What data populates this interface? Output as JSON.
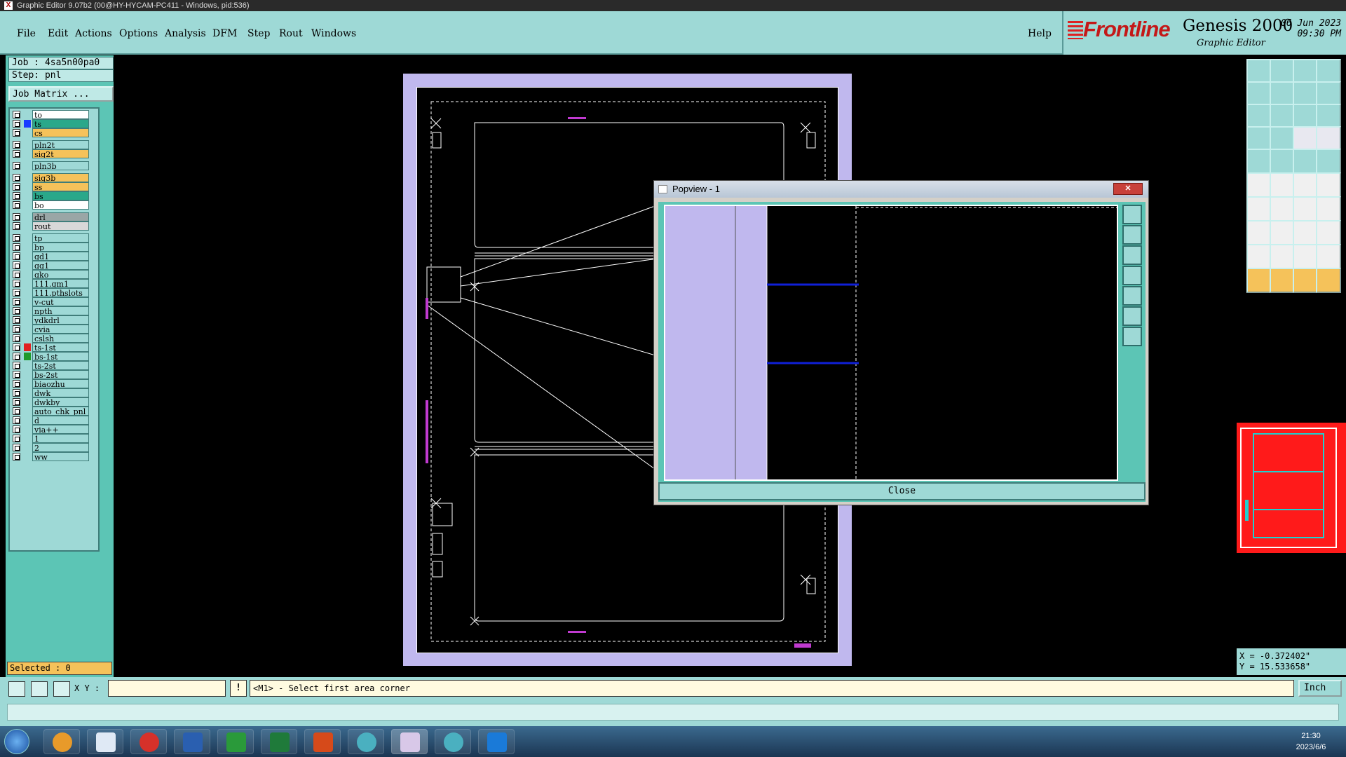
{
  "window": {
    "title": "Graphic Editor 9.07b2 (00@HY-HYCAM-PC411 - Windows, pid:536)"
  },
  "menu": {
    "items": [
      "File",
      "Edit",
      "Actions",
      "Options",
      "Analysis",
      "DFM",
      "Step",
      "Rout",
      "Windows"
    ],
    "help": "Help"
  },
  "brand": {
    "logo": "Frontline",
    "product": "Genesis 2000",
    "subtitle": "Graphic Editor",
    "date": "06 Jun 2023",
    "time": "09:30 PM"
  },
  "job": {
    "job_label": "Job : 4sa5n00pa0",
    "step_label": "Step: pnl",
    "matrix_button": "Job Matrix ..."
  },
  "layers": [
    {
      "name": "to",
      "color": "#ffffff",
      "swatch": ""
    },
    {
      "name": "ts",
      "color": "#2aa88a",
      "swatch": "#1a3cff"
    },
    {
      "name": "cs",
      "color": "#f5c25a",
      "swatch": ""
    },
    {
      "name": "pln2t",
      "color": "#9ed9d6",
      "swatch": ""
    },
    {
      "name": "sig2t",
      "color": "#f5c25a",
      "swatch": ""
    },
    {
      "name": "pln3b",
      "color": "#9ed9d6",
      "swatch": ""
    },
    {
      "name": "sig3b",
      "color": "#f5c25a",
      "swatch": ""
    },
    {
      "name": "ss",
      "color": "#f5c25a",
      "swatch": ""
    },
    {
      "name": "bs",
      "color": "#2aa88a",
      "swatch": ""
    },
    {
      "name": "bo",
      "color": "#ffffff",
      "swatch": ""
    },
    {
      "name": "drl",
      "color": "#9aa6a6",
      "swatch": ""
    },
    {
      "name": "rout",
      "color": "#d8d8d8",
      "swatch": ""
    },
    {
      "name": "tp",
      "color": "#9ed9d6",
      "swatch": ""
    },
    {
      "name": "bp",
      "color": "#9ed9d6",
      "swatch": ""
    },
    {
      "name": "gd1",
      "color": "#9ed9d6",
      "swatch": ""
    },
    {
      "name": "gg1",
      "color": "#9ed9d6",
      "swatch": ""
    },
    {
      "name": "gko",
      "color": "#9ed9d6",
      "swatch": ""
    },
    {
      "name": "111.gm1",
      "color": "#9ed9d6",
      "swatch": ""
    },
    {
      "name": "111.pthslots",
      "color": "#9ed9d6",
      "swatch": ""
    },
    {
      "name": "v-cut",
      "color": "#9ed9d6",
      "swatch": ""
    },
    {
      "name": "npth",
      "color": "#9ed9d6",
      "swatch": ""
    },
    {
      "name": "ydkdrl",
      "color": "#9ed9d6",
      "swatch": ""
    },
    {
      "name": "cvia",
      "color": "#9ed9d6",
      "swatch": ""
    },
    {
      "name": "cslsh",
      "color": "#9ed9d6",
      "swatch": ""
    },
    {
      "name": "ts-1st",
      "color": "#9ed9d6",
      "swatch": "#e02020"
    },
    {
      "name": "bs-1st",
      "color": "#9ed9d6",
      "swatch": "#1f9a2a"
    },
    {
      "name": "ts-2st",
      "color": "#9ed9d6",
      "swatch": ""
    },
    {
      "name": "bs-2st",
      "color": "#9ed9d6",
      "swatch": ""
    },
    {
      "name": "biaozhu",
      "color": "#9ed9d6",
      "swatch": ""
    },
    {
      "name": "dwk",
      "color": "#9ed9d6",
      "swatch": ""
    },
    {
      "name": "dwkby",
      "color": "#9ed9d6",
      "swatch": ""
    },
    {
      "name": "auto_chk_pnl",
      "color": "#9ed9d6",
      "swatch": ""
    },
    {
      "name": "d",
      "color": "#9ed9d6",
      "swatch": ""
    },
    {
      "name": "via++",
      "color": "#9ed9d6",
      "swatch": ""
    },
    {
      "name": "1",
      "color": "#9ed9d6",
      "swatch": ""
    },
    {
      "name": "2",
      "color": "#9ed9d6",
      "swatch": ""
    },
    {
      "name": "ww",
      "color": "#9ed9d6",
      "swatch": ""
    }
  ],
  "selected": "Selected : 0",
  "popup": {
    "title": "Popview - 1",
    "close_button": "Close"
  },
  "coords": {
    "x": "X = -0.372402\"",
    "y": "Y = 15.533658\""
  },
  "cmd": {
    "xy_label": "X Y :",
    "xy_value": "",
    "info_icon": "!",
    "prompt": "<M1> - Select first area corner",
    "units": "Inch"
  },
  "clock": {
    "time": "21:30",
    "date": "2023/6/6"
  },
  "colors": {
    "accent": "#9ed9d6",
    "panel": "#5cc5b5",
    "board": "#c0b8ee",
    "highlight": "#f5c25a"
  }
}
